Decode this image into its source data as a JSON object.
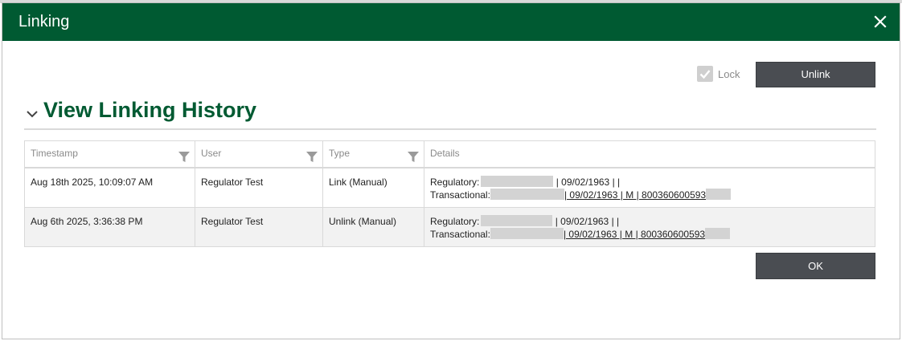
{
  "dialog": {
    "title": "Linking",
    "close_icon": "close-icon"
  },
  "toolbar": {
    "lock_label": "Lock",
    "lock_checked": true,
    "unlink_label": "Unlink"
  },
  "section": {
    "title": "View Linking History",
    "chevron_icon": "chevron-down-icon"
  },
  "grid": {
    "columns": [
      {
        "label": "Timestamp",
        "filterable": true
      },
      {
        "label": "User",
        "filterable": true
      },
      {
        "label": "Type",
        "filterable": true
      },
      {
        "label": "Details",
        "filterable": false
      }
    ],
    "rows": [
      {
        "timestamp": "Aug 18th 2025, 10:09:07 AM",
        "user": "Regulator Test",
        "type": "Link (Manual)",
        "details_regulatory_label": "Regulatory:",
        "details_regulatory_value": "| 09/02/1963 | |",
        "details_transactional_label": "Transactional:",
        "details_transactional_value": "| 09/02/1963 | M | 800360600593"
      },
      {
        "timestamp": "Aug 6th 2025, 3:36:38 PM",
        "user": "Regulator Test",
        "type": "Unlink (Manual)",
        "details_regulatory_label": "Regulatory:",
        "details_regulatory_value": "| 09/02/1963 | |",
        "details_transactional_label": "Transactional:",
        "details_transactional_value": "| 09/02/1963 | M | 800360600593"
      }
    ]
  },
  "footer": {
    "ok_label": "OK"
  },
  "colors": {
    "brand_green": "#005a32",
    "button_dark": "#4a4d52",
    "redaction": "#d3d3d3"
  }
}
